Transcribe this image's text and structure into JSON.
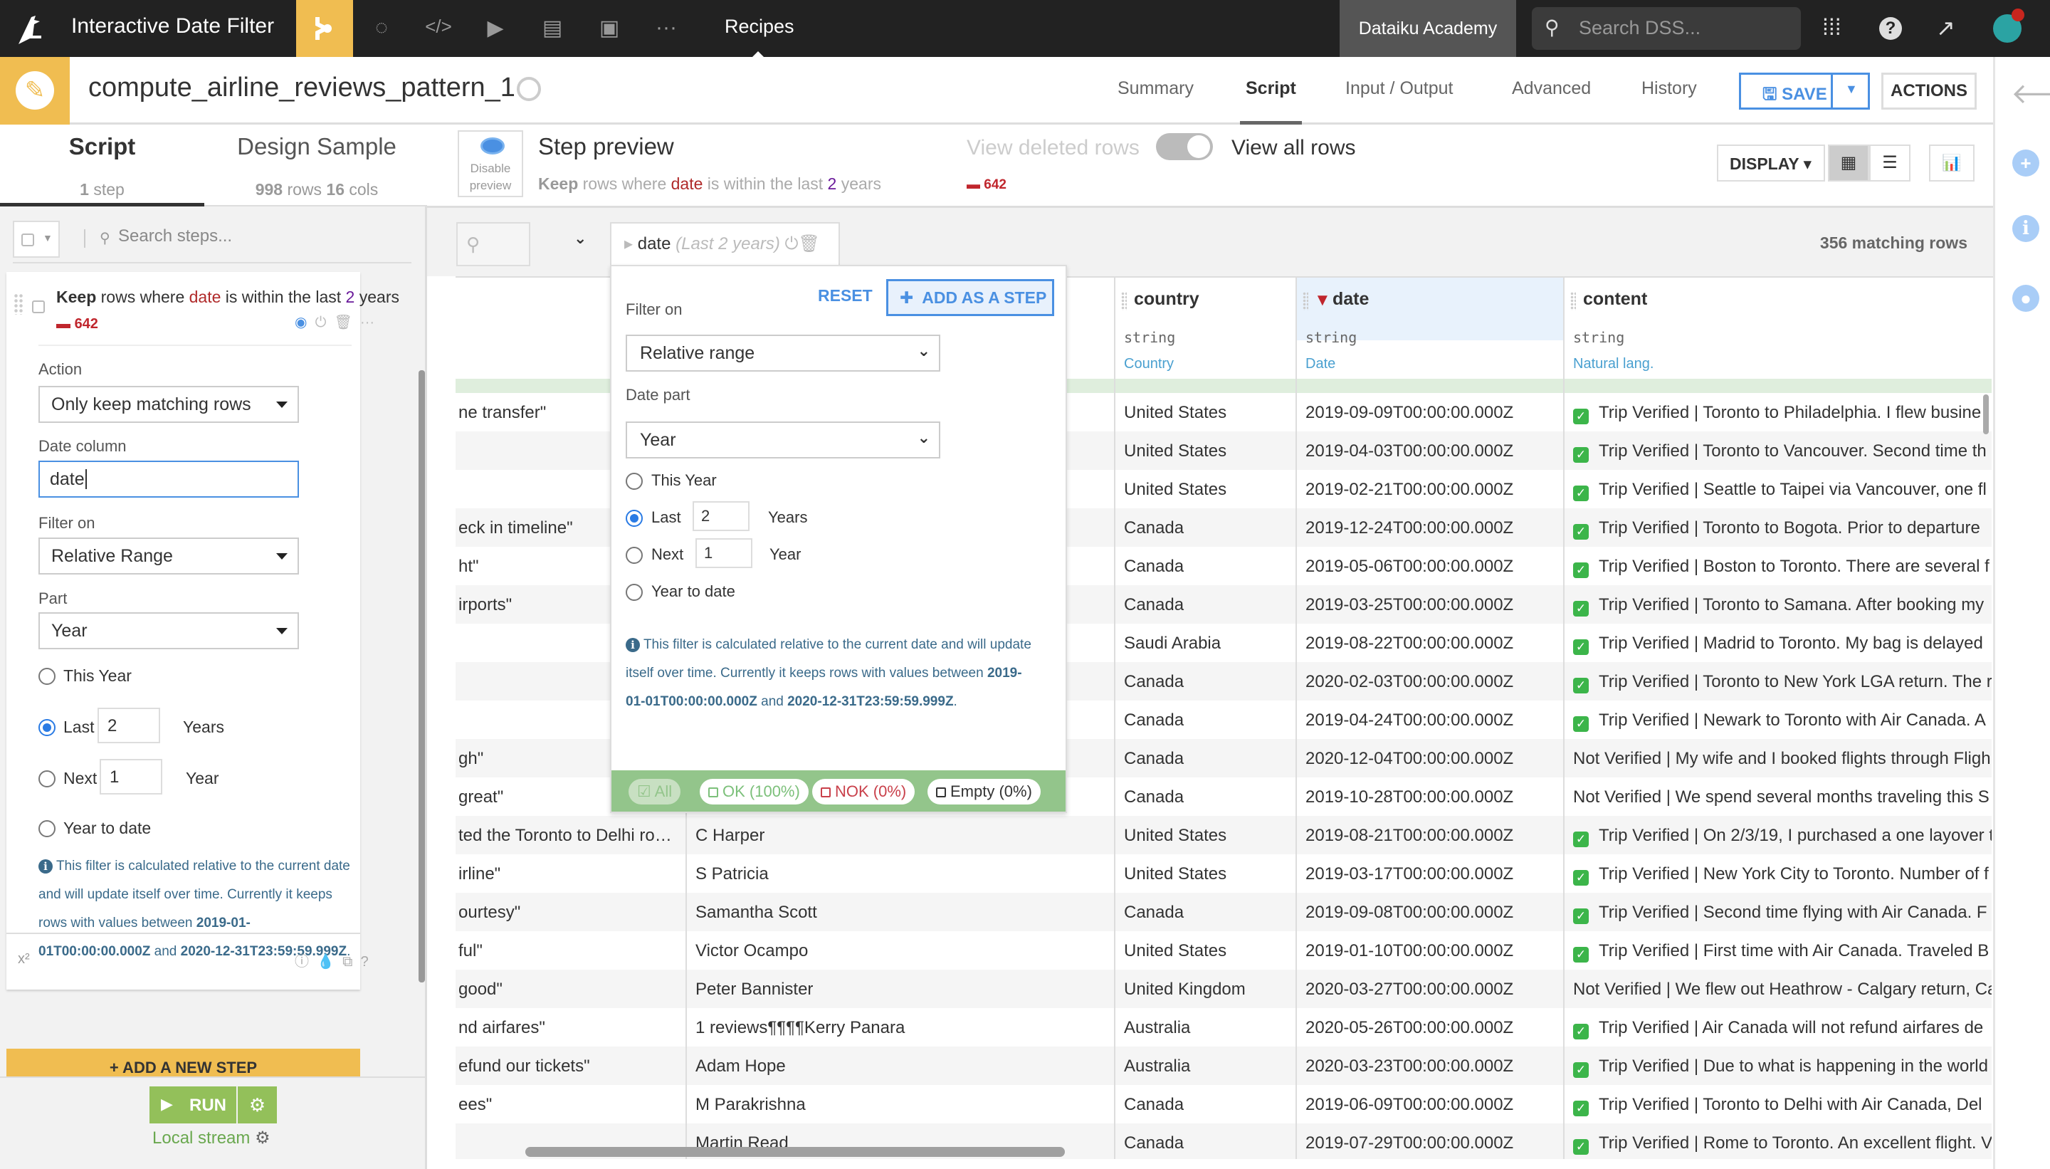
{
  "topbar": {
    "project_title": "Interactive Date Filter",
    "nav_section": "Recipes",
    "instance": "Dataiku Academy",
    "search_placeholder": "Search DSS..."
  },
  "recipe": {
    "name": "compute_airline_reviews_pattern_1",
    "tabs": [
      "Summary",
      "Script",
      "Input / Output",
      "Advanced",
      "History"
    ],
    "active_tab": "Script",
    "save_label": "SAVE",
    "actions_label": "ACTIONS"
  },
  "left_panel": {
    "tab_script": "Script",
    "tab_design_sample": "Design Sample",
    "steps_count": "1",
    "steps_label": "step",
    "sample_rows": "998",
    "sample_rows_label": "rows",
    "sample_cols": "16",
    "sample_cols_label": "cols",
    "search_placeholder": "Search steps...",
    "step": {
      "verb": "Keep",
      "text1": "rows where",
      "column": "date",
      "text2": "is within the last",
      "n": "2",
      "unit": "years",
      "removed": "642",
      "action_label": "Action",
      "action_value": "Only keep matching rows",
      "date_column_label": "Date column",
      "date_column_value": "date",
      "filter_on_label": "Filter on",
      "filter_on_value": "Relative Range",
      "part_label": "Part",
      "part_value": "Year",
      "options": {
        "this_year": "This Year",
        "last": "Last",
        "last_value": "2",
        "last_unit": "Years",
        "next": "Next",
        "next_value": "1",
        "next_unit": "Year",
        "year_to_date": "Year to date",
        "selected": "last"
      },
      "info_text1": "This filter is calculated relative to the current date and will update itself over time. Currently it keeps rows with values between",
      "range_start": "2019-01-01T00:00:00.000Z",
      "info_and": "and",
      "range_end": "2020-12-31T23:59:59.999Z"
    },
    "add_step_label": "+ ADD A NEW STEP",
    "run_label": "RUN",
    "engine_label": "Local stream"
  },
  "preview": {
    "disable_label": "Disable preview",
    "title": "Step preview",
    "sub_verb": "Keep",
    "sub_text1": "rows where",
    "sub_column": "date",
    "sub_text2": "is within the last",
    "sub_n": "2",
    "sub_unit": "years",
    "removed": "642",
    "view_deleted": "View deleted rows",
    "view_all": "View all rows",
    "display_label": "DISPLAY",
    "matching_rows": "356 matching rows"
  },
  "filter_chip": {
    "column": "date",
    "detail": "(Last 2 years)"
  },
  "popup": {
    "filter_on_label": "Filter on",
    "reset_label": "RESET",
    "add_step_label": "ADD AS A STEP",
    "filter_on_value": "Relative range",
    "date_part_label": "Date part",
    "date_part_value": "Year",
    "this_year": "This Year",
    "last": "Last",
    "last_value": "2",
    "last_unit": "Years",
    "next": "Next",
    "next_value": "1",
    "next_unit": "Year",
    "year_to_date": "Year to date",
    "info_text": "This filter is calculated relative to the current date and will update itself over time. Currently it keeps rows with values between",
    "range_start": "2019-01-01T00:00:00.000Z",
    "info_and": "and",
    "range_end": "2020-12-31T23:59:59.999Z",
    "pills": {
      "all": "All",
      "ok": "OK (100%)",
      "nok": "NOK (0%)",
      "empty": "Empty (0%)"
    }
  },
  "table": {
    "columns": [
      {
        "name": "",
        "type": "",
        "meaning": ""
      },
      {
        "name": "",
        "type": "",
        "meaning": ""
      },
      {
        "name": "country",
        "type": "string",
        "meaning": "Country"
      },
      {
        "name": "date",
        "type": "string",
        "meaning": "Date"
      },
      {
        "name": "content",
        "type": "string",
        "meaning": "Natural lang."
      }
    ],
    "rows": [
      {
        "title": "ne transfer\"",
        "author": "",
        "country": "United States",
        "date": "2019-09-09T00:00:00.000Z",
        "verified": true,
        "content": "Trip Verified |  Toronto to Philadelphia. I flew busine"
      },
      {
        "title": "",
        "author": "",
        "country": "United States",
        "date": "2019-04-03T00:00:00.000Z",
        "verified": true,
        "content": "Trip Verified |  Toronto to Vancouver. Second time th"
      },
      {
        "title": "",
        "author": "",
        "country": "United States",
        "date": "2019-02-21T00:00:00.000Z",
        "verified": true,
        "content": "Trip Verified |  Seattle to Taipei via Vancouver, one fl"
      },
      {
        "title": "eck in timeline\"",
        "author": "",
        "country": "Canada",
        "date": "2019-12-24T00:00:00.000Z",
        "verified": true,
        "content": "Trip Verified |  Toronto to Bogota. Prior to departure"
      },
      {
        "title": "ht\"",
        "author": "",
        "country": "Canada",
        "date": "2019-05-06T00:00:00.000Z",
        "verified": true,
        "content": "Trip Verified |  Boston to Toronto. There are several f"
      },
      {
        "title": "irports\"",
        "author": "",
        "country": "Canada",
        "date": "2019-03-25T00:00:00.000Z",
        "verified": true,
        "content": "Trip Verified |  Toronto to Samana. After booking my"
      },
      {
        "title": "",
        "author": "",
        "country": "Saudi Arabia",
        "date": "2019-08-22T00:00:00.000Z",
        "verified": true,
        "content": "Trip Verified |  Madrid to Toronto. My bag is delayed"
      },
      {
        "title": "",
        "author": "",
        "country": "Canada",
        "date": "2020-02-03T00:00:00.000Z",
        "verified": true,
        "content": "Trip Verified |  Toronto to New York LGA return. The r"
      },
      {
        "title": "",
        "author": "",
        "country": "Canada",
        "date": "2019-04-24T00:00:00.000Z",
        "verified": true,
        "content": "Trip Verified | Newark to Toronto with Air Canada. A"
      },
      {
        "title": "gh\"",
        "author": "",
        "country": "Canada",
        "date": "2020-12-04T00:00:00.000Z",
        "verified": false,
        "content": "Not Verified |  My wife and I booked flights through Fligh"
      },
      {
        "title": "great\"",
        "author": "",
        "country": "Canada",
        "date": "2019-10-28T00:00:00.000Z",
        "verified": false,
        "content": "Not Verified |  We spend several months traveling this S"
      },
      {
        "title": "ted the Toronto to Delhi ro…",
        "author": "C Harper",
        "country": "United States",
        "date": "2019-08-21T00:00:00.000Z",
        "verified": true,
        "content": "Trip Verified | On 2/3/19, I purchased a one layover t"
      },
      {
        "title": "irline\"",
        "author": "S Patricia",
        "country": "United States",
        "date": "2019-03-17T00:00:00.000Z",
        "verified": true,
        "content": "Trip Verified | New York City to Toronto. Number of f"
      },
      {
        "title": "ourtesy\"",
        "author": "Samantha Scott",
        "country": "Canada",
        "date": "2019-09-08T00:00:00.000Z",
        "verified": true,
        "content": "Trip Verified |  Second time flying with Air Canada. F"
      },
      {
        "title": "ful\"",
        "author": "Victor Ocampo",
        "country": "United States",
        "date": "2019-01-10T00:00:00.000Z",
        "verified": true,
        "content": "Trip Verified |  First time with Air Canada. Traveled B"
      },
      {
        "title": "good\"",
        "author": "Peter Bannister",
        "country": "United Kingdom",
        "date": "2020-03-27T00:00:00.000Z",
        "verified": false,
        "content": "Not Verified |  We flew out Heathrow - Calgary return, Ca"
      },
      {
        "title": "nd airfares\"",
        "author": "1 reviews¶¶¶¶Kerry Panara",
        "country": "Australia",
        "date": "2020-05-26T00:00:00.000Z",
        "verified": true,
        "content": "Trip Verified |  Air Canada will not refund airfares de"
      },
      {
        "title": "efund our tickets\"",
        "author": "Adam Hope",
        "country": "Australia",
        "date": "2020-03-23T00:00:00.000Z",
        "verified": true,
        "content": "Trip Verified | Due to what is happening in the world"
      },
      {
        "title": "ees\"",
        "author": "M Parakrishna",
        "country": "Canada",
        "date": "2019-06-09T00:00:00.000Z",
        "verified": true,
        "content": "Trip Verified |  Toronto to Delhi with Air Canada, Del"
      },
      {
        "title": "",
        "author": "Martin Read",
        "country": "Canada",
        "date": "2019-07-29T00:00:00.000Z",
        "verified": true,
        "content": "Trip Verified |  Rome to Toronto. An excellent flight. V"
      }
    ]
  },
  "colors": {
    "accent_yellow": "#f0bd51",
    "accent_blue": "#4a90e2",
    "run_green": "#93c05a",
    "removed_red": "#c0262d"
  }
}
